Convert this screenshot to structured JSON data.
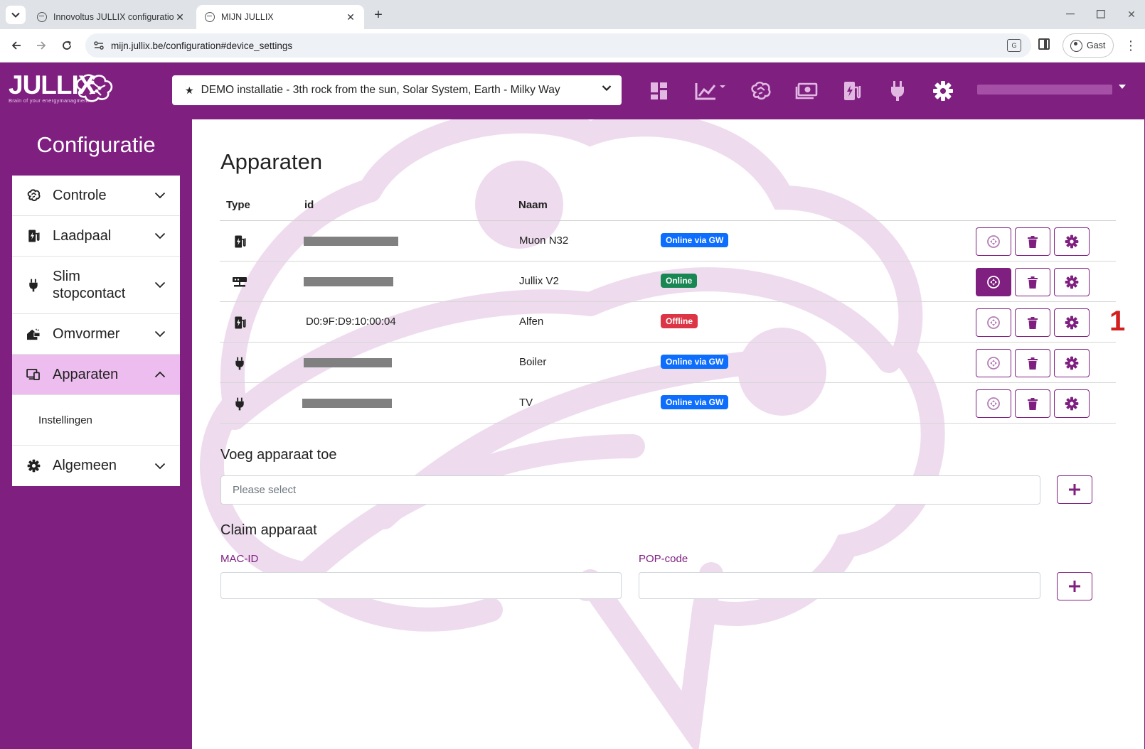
{
  "browser": {
    "tabs": [
      {
        "title": "Innovoltus JULLIX configuration",
        "active": false
      },
      {
        "title": "MIJN JULLIX",
        "active": true
      }
    ],
    "url": "mijn.jullix.be/configuration#device_settings",
    "profile_label": "Gast"
  },
  "header": {
    "logo_text": "JULLIX",
    "logo_tagline": "Brain of your energymanagment",
    "installation": "DEMO installatie - 3th rock from the sun, Solar System, Earth - Milky Way",
    "nav_icons": [
      "dashboard-icon",
      "chart-icon",
      "brain-icon",
      "money-icon",
      "charging-station-icon",
      "plug-icon",
      "gear-icon"
    ],
    "brand_color": "#7f1f80"
  },
  "sidebar": {
    "title": "Configuratie",
    "items": [
      {
        "label": "Controle",
        "icon": "brain-icon",
        "expanded": false
      },
      {
        "label": "Laadpaal",
        "icon": "charging-station-icon",
        "expanded": false
      },
      {
        "label": "Slim stopcontact",
        "icon": "plug-icon",
        "expanded": false
      },
      {
        "label": "Omvormer",
        "icon": "solar-home-icon",
        "expanded": false
      },
      {
        "label": "Apparaten",
        "icon": "devices-icon",
        "expanded": true,
        "sub": [
          "Instellingen"
        ]
      },
      {
        "label": "Algemeen",
        "icon": "gear-icon",
        "expanded": false
      }
    ]
  },
  "main": {
    "title": "Apparaten",
    "columns": [
      "Type",
      "id",
      "Naam"
    ],
    "devices": [
      {
        "type_icon": "charging-station-icon",
        "id": "",
        "id_redacted": true,
        "name": "Muon N32",
        "status": "Online via GW",
        "status_color": "#0d6efd",
        "focus_active": false
      },
      {
        "type_icon": "gateway-icon",
        "id": "",
        "id_redacted": true,
        "name": "Jullix V2",
        "status": "Online",
        "status_color": "#198754",
        "focus_active": true
      },
      {
        "type_icon": "charging-station-icon",
        "id": "D0:9F:D9:10:00:04",
        "id_redacted": false,
        "name": "Alfen",
        "status": "Offline",
        "status_color": "#dc3545",
        "focus_active": false
      },
      {
        "type_icon": "plug-icon",
        "id": "",
        "id_redacted": true,
        "name": "Boiler",
        "status": "Online via GW",
        "status_color": "#0d6efd",
        "focus_active": false
      },
      {
        "type_icon": "plug-icon",
        "id": "",
        "id_redacted": true,
        "name": "TV",
        "status": "Online via GW",
        "status_color": "#0d6efd",
        "focus_active": false
      }
    ],
    "annotation_marker": "1",
    "add_device": {
      "title": "Voeg apparaat toe",
      "placeholder": "Please select"
    },
    "claim_device": {
      "title": "Claim apparaat",
      "mac_label": "MAC-ID",
      "mac_value": "",
      "pop_label": "POP-code",
      "pop_value": ""
    }
  }
}
